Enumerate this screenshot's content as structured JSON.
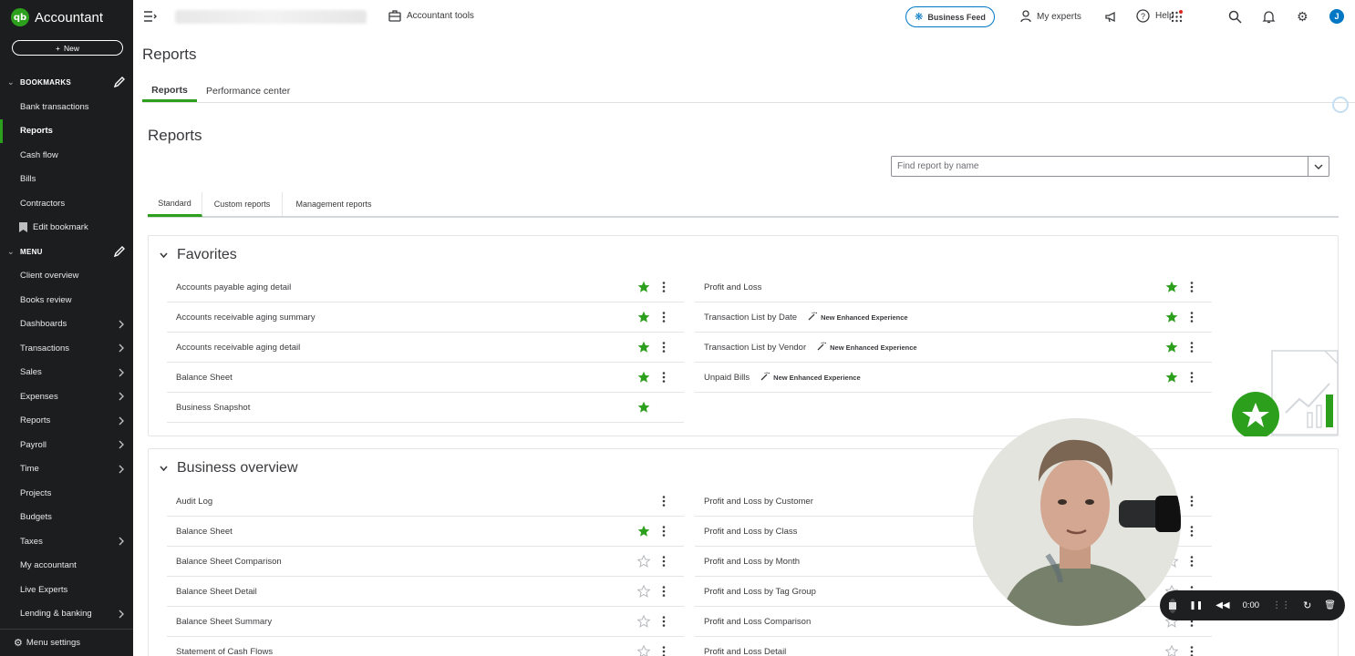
{
  "sidebar": {
    "logo_glyph": "qb",
    "app_name": "Accountant",
    "new_label": "New",
    "bookmarks_header": "BOOKMARKS",
    "bookmarks": [
      "Bank transactions",
      "Reports",
      "Cash flow",
      "Bills",
      "Contractors"
    ],
    "edit_bookmark": "Edit bookmark",
    "menu_header": "MENU",
    "menu": [
      {
        "label": "Client overview",
        "chevron": false
      },
      {
        "label": "Books review",
        "chevron": false
      },
      {
        "label": "Dashboards",
        "chevron": true
      },
      {
        "label": "Transactions",
        "chevron": true
      },
      {
        "label": "Sales",
        "chevron": true
      },
      {
        "label": "Expenses",
        "chevron": true
      },
      {
        "label": "Reports",
        "chevron": true
      },
      {
        "label": "Payroll",
        "chevron": true
      },
      {
        "label": "Time",
        "chevron": true
      },
      {
        "label": "Projects",
        "chevron": false
      },
      {
        "label": "Budgets",
        "chevron": false
      },
      {
        "label": "Taxes",
        "chevron": true
      },
      {
        "label": "My accountant",
        "chevron": false
      },
      {
        "label": "Live Experts",
        "chevron": false
      },
      {
        "label": "Lending & banking",
        "chevron": true
      }
    ],
    "menu_settings": "Menu settings"
  },
  "topbar": {
    "accountant_tools": "Accountant tools",
    "business_feed": "Business Feed",
    "my_experts": "My experts",
    "help": "Help",
    "avatar_initial": "J"
  },
  "page": {
    "title": "Reports",
    "tabs": [
      "Reports",
      "Performance center"
    ],
    "subtitle": "Reports",
    "search_placeholder": "Find report by name",
    "report_tabs": [
      "Standard",
      "Custom reports",
      "Management reports"
    ]
  },
  "favorites": {
    "title": "Favorites",
    "left": [
      {
        "name": "Accounts payable aging detail",
        "starred": true,
        "more": true
      },
      {
        "name": "Accounts receivable aging summary",
        "starred": true,
        "more": true
      },
      {
        "name": "Accounts receivable aging detail",
        "starred": true,
        "more": true
      },
      {
        "name": "Balance Sheet",
        "starred": true,
        "more": true
      },
      {
        "name": "Business Snapshot",
        "starred": true,
        "more": false
      }
    ],
    "right": [
      {
        "name": "Profit and Loss",
        "badge": "",
        "starred": true
      },
      {
        "name": "Transaction List by Date",
        "badge": "New Enhanced Experience",
        "starred": true
      },
      {
        "name": "Transaction List by Vendor",
        "badge": "New Enhanced Experience",
        "starred": true
      },
      {
        "name": "Unpaid Bills",
        "badge": "New Enhanced Experience",
        "starred": true
      }
    ]
  },
  "business_overview": {
    "title": "Business overview",
    "left": [
      {
        "name": "Audit Log",
        "star": "none"
      },
      {
        "name": "Balance Sheet",
        "star": "filled"
      },
      {
        "name": "Balance Sheet Comparison",
        "star": "outline"
      },
      {
        "name": "Balance Sheet Detail",
        "star": "outline"
      },
      {
        "name": "Balance Sheet Summary",
        "star": "outline"
      },
      {
        "name": "Statement of Cash Flows",
        "star": "outline"
      }
    ],
    "right": [
      {
        "name": "Profit and Loss by Customer"
      },
      {
        "name": "Profit and Loss by Class"
      },
      {
        "name": "Profit and Loss by Month"
      },
      {
        "name": "Profit and Loss by Tag Group"
      },
      {
        "name": "Profit and Loss Comparison"
      },
      {
        "name": "Profit and Loss Detail"
      }
    ]
  },
  "recorder": {
    "time": "0:00"
  },
  "colors": {
    "sidebar_bg": "#1c1d1e",
    "brand_green": "#2ca01c",
    "accent_blue": "#0077c5",
    "text": "#393a3d"
  }
}
